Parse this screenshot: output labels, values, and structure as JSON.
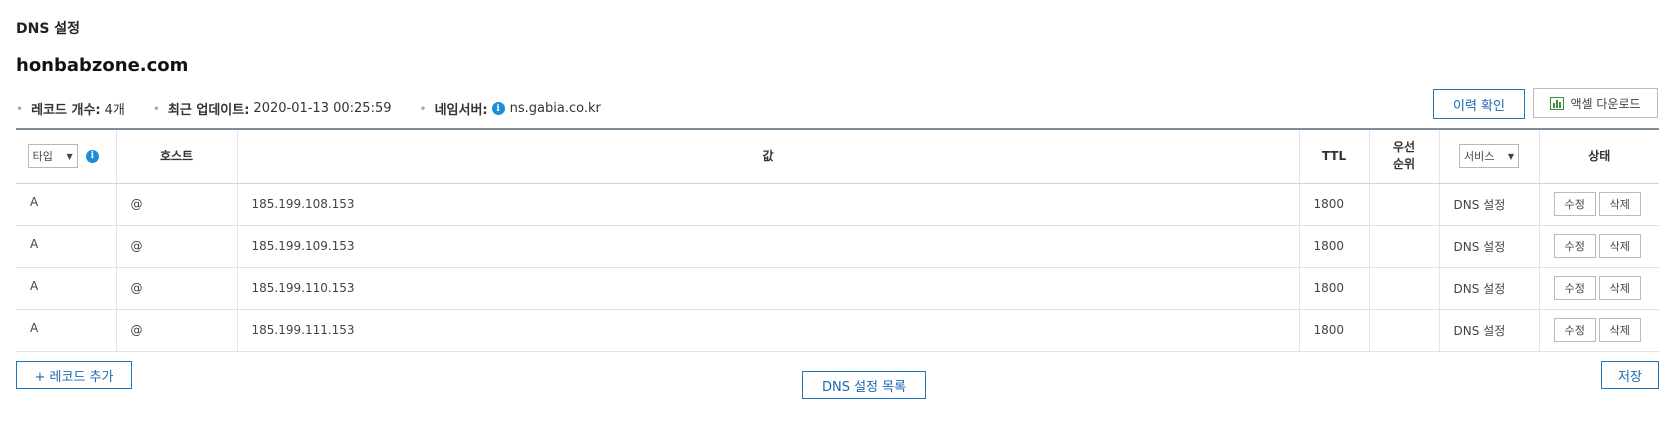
{
  "page": {
    "heading": "DNS 설정",
    "domain": "honbabzone.com"
  },
  "meta": {
    "record_count_label": "레코드 개수:",
    "record_count_value": "4개",
    "last_update_label": "최근 업데이트:",
    "last_update_value": "2020-01-13 00:25:59",
    "nameserver_label": "네임서버:",
    "nameserver_value": "ns.gabia.co.kr"
  },
  "toolbar": {
    "history_label": "이력 확인",
    "excel_label": "액셀 다운로드"
  },
  "table": {
    "headers": {
      "type_select": "타입",
      "host": "호스트",
      "value": "값",
      "ttl": "TTL",
      "priority_line1": "우선",
      "priority_line2": "순위",
      "service_select": "서비스",
      "status": "상태"
    },
    "rows": [
      {
        "type": "A",
        "host": "@",
        "value": "185.199.108.153",
        "ttl": "1800",
        "priority": "",
        "service": "DNS 설정",
        "edit": "수정",
        "delete": "삭제"
      },
      {
        "type": "A",
        "host": "@",
        "value": "185.199.109.153",
        "ttl": "1800",
        "priority": "",
        "service": "DNS 설정",
        "edit": "수정",
        "delete": "삭제"
      },
      {
        "type": "A",
        "host": "@",
        "value": "185.199.110.153",
        "ttl": "1800",
        "priority": "",
        "service": "DNS 설정",
        "edit": "수정",
        "delete": "삭제"
      },
      {
        "type": "A",
        "host": "@",
        "value": "185.199.111.153",
        "ttl": "1800",
        "priority": "",
        "service": "DNS 설정",
        "edit": "수정",
        "delete": "삭제"
      }
    ]
  },
  "footer": {
    "add_record_label": "+ 레코드 추가",
    "dns_list_label": "DNS 설정 목록",
    "save_label": "저장"
  },
  "colors": {
    "accent": "#1a78c2",
    "info_icon": "#1a8ed8",
    "excel_icon": "#3d8f3d"
  }
}
